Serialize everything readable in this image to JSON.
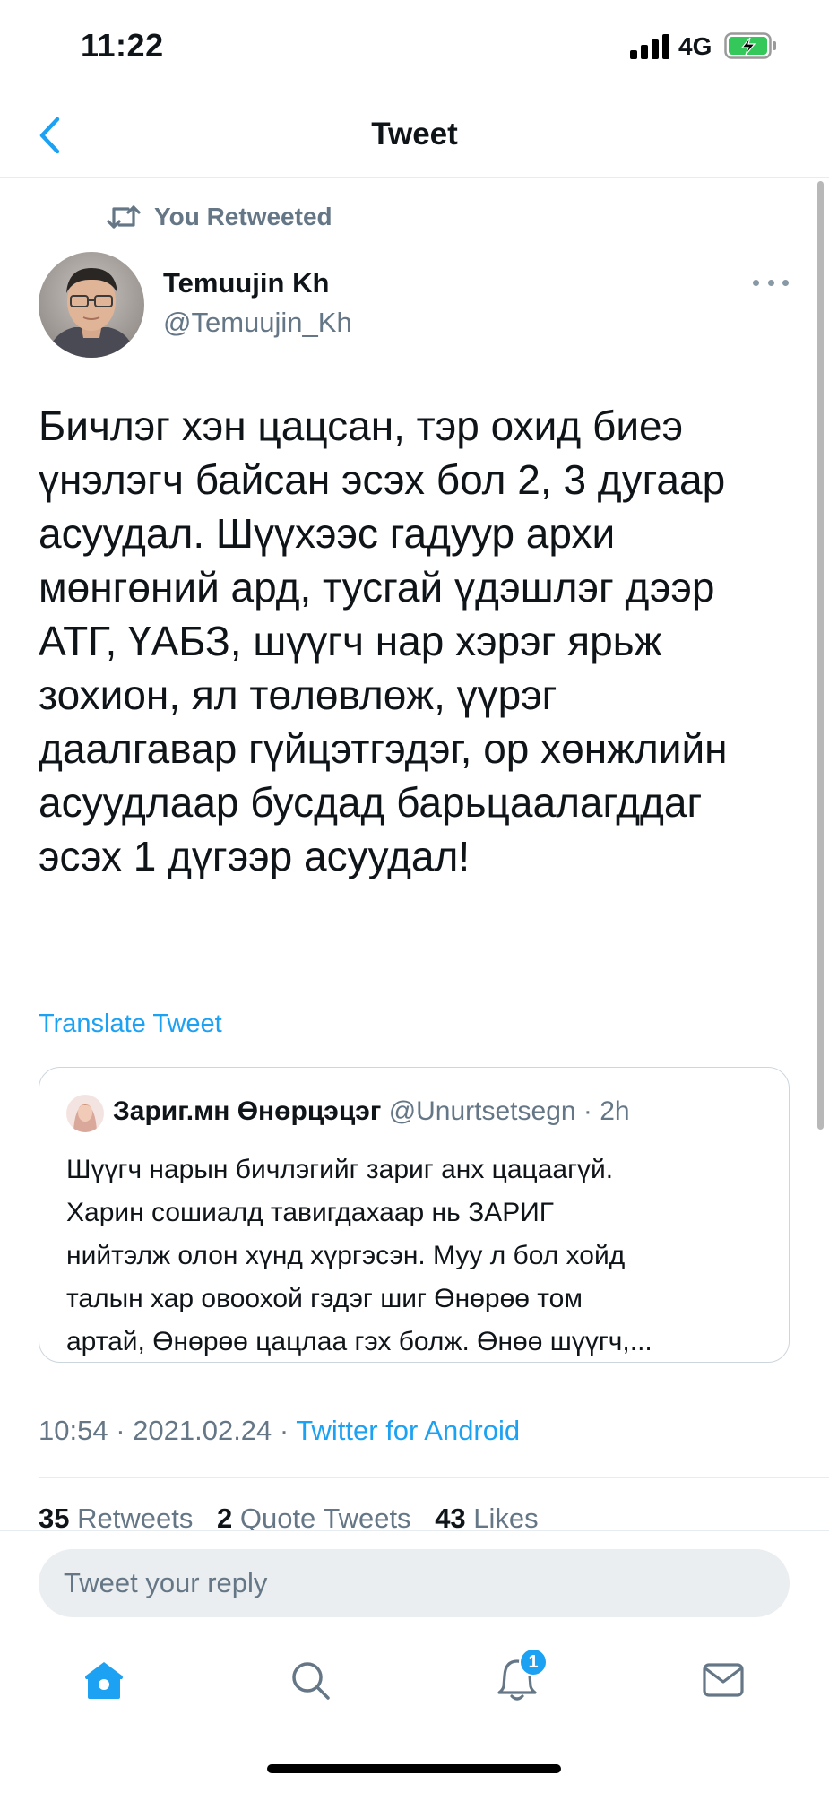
{
  "status_bar": {
    "time": "11:22",
    "network": "4G",
    "battery_color": "#34c759"
  },
  "nav": {
    "title": "Tweet",
    "back_icon": "chevron-left-icon"
  },
  "retweet": {
    "label": "You Retweeted",
    "icon": "retweet-icon"
  },
  "author": {
    "name": "Temuujin Kh",
    "handle": "@Temuujin_Kh",
    "avatar_icon": "avatar-photo"
  },
  "tweet": {
    "lines": [
      "Бичлэг хэн цацсан, тэр охид биеэ",
      "үнэлэгч байсан эсэх бол 2, 3 дугаар",
      "асуудал. Шүүхээс гадуур архи",
      "мөнгөний ард, тусгай үдэшлэг дээр",
      "АТГ, ҮАБЗ, шүүгч нар хэрэг ярьж",
      "зохион, ял төлөвлөж, үүрэг",
      "даалгавар гүйцэтгэдэг, ор хөнжлийн",
      "асуудлаар бусдад барьцаалагддаг",
      "эсэх 1 дүгээр асуудал!"
    ],
    "translate_label": "Translate Tweet"
  },
  "quote": {
    "name": "Зариг.мн Өнөрцэцэг",
    "handle": "@Unurtsetsegn",
    "time": "2h",
    "separator": " · ",
    "lines": [
      "Шүүгч нарын бичлэгийг зариг анх цацаагүй.",
      "Харин сошиалд тавигдахаар нь ЗАРИГ",
      "нийтэлж олон хүнд хүргэсэн. Муу л бол хойд",
      "талын хар овоохой гэдэг шиг Өнөрөө том",
      "артай, Өнөрөө цацлаа гэх болж. Өнөө шүүгч,..."
    ]
  },
  "meta": {
    "time": "10:54",
    "date": "2021.02.24",
    "source": "Twitter for Android",
    "separator": " · "
  },
  "stats": {
    "retweets_count": "35",
    "retweets_label": "Retweets",
    "quotes_count": "2",
    "quotes_label": "Quote Tweets",
    "likes_count": "43",
    "likes_label": "Likes"
  },
  "reply": {
    "placeholder": "Tweet your reply"
  },
  "tabs": {
    "notifications_badge": "1",
    "items": [
      "home-icon",
      "search-icon",
      "bell-icon",
      "mail-icon"
    ]
  },
  "colors": {
    "accent": "#1da1f2",
    "secondary_text": "#657786",
    "border": "#ccd6dd"
  }
}
